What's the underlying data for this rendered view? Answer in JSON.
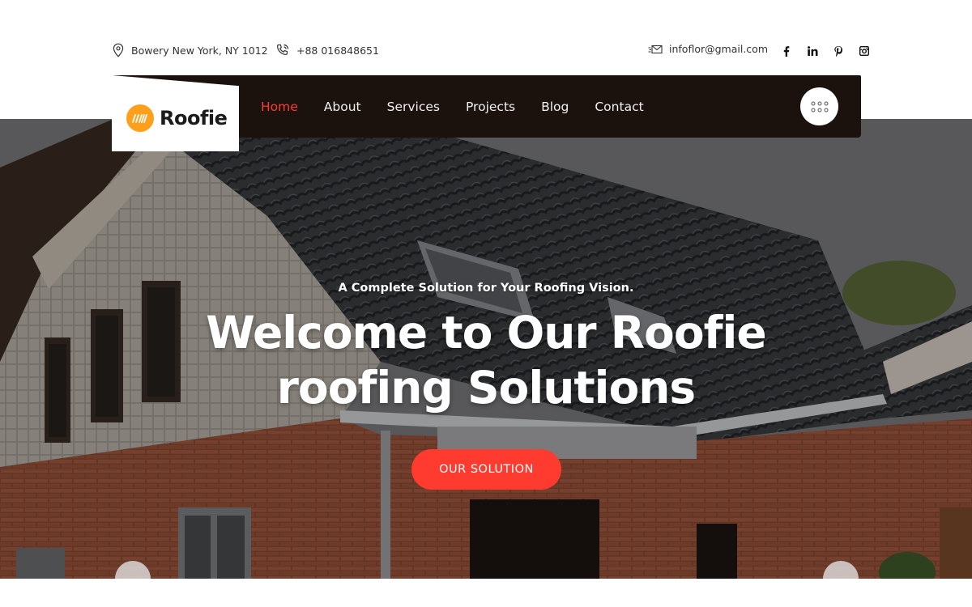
{
  "topbar": {
    "address": "Bowery New York, NY 1012",
    "phone": "+88 016848651",
    "email": "infoflor@gmail.com",
    "socials": [
      {
        "icon": "facebook-icon",
        "glyph": "f"
      },
      {
        "icon": "linkedin-icon",
        "glyph": "in"
      },
      {
        "icon": "pinterest-icon",
        "glyph": "p"
      },
      {
        "icon": "instagram-icon",
        "glyph": "ig"
      }
    ]
  },
  "brand": {
    "name": "Roofie",
    "logo_color": "#ff9f1c"
  },
  "nav": {
    "items": [
      {
        "label": "Home",
        "active": true
      },
      {
        "label": "About",
        "active": false
      },
      {
        "label": "Services",
        "active": false
      },
      {
        "label": "Projects",
        "active": false
      },
      {
        "label": "Blog",
        "active": false
      },
      {
        "label": "Contact",
        "active": false
      }
    ],
    "menu_icon": "grid-dots-icon",
    "accent": "#ff3b30",
    "bar_color": "#1b120e"
  },
  "hero": {
    "subtitle": "A Complete Solution for Your Roofing Vision.",
    "title_line1": "Welcome to Our Roofie",
    "title_line2": "roofing Solutions",
    "cta_label": "OUR SOLUTION",
    "cta_color": "#ff3b30"
  }
}
